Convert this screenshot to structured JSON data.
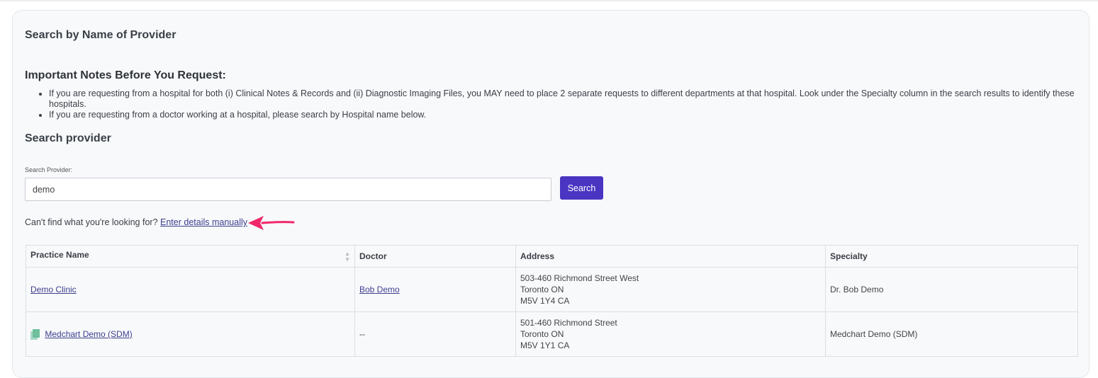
{
  "section_title": "Search by Name of Provider",
  "notes": {
    "title": "Important Notes Before You Request:",
    "items": [
      "If you are requesting from a hospital for both (i) Clinical Notes & Records and (ii) Diagnostic Imaging Files, you MAY need to place 2 separate requests to different departments at that hospital. Look under the Specialty column in the search results to identify these hospitals.",
      "If you are requesting from a doctor working at a hospital, please search by Hospital name below."
    ]
  },
  "search": {
    "title": "Search provider",
    "label": "Search Provider:",
    "value": "demo",
    "button_label": "Search"
  },
  "manual": {
    "prompt": "Can't find what you're looking for?",
    "link_label": "Enter details manually"
  },
  "table": {
    "headers": [
      "Practice Name",
      "Doctor",
      "Address",
      "Specialty"
    ],
    "rows": [
      {
        "practice": "Demo Clinic",
        "doctor": "Bob Demo",
        "address": [
          "503-460 Richmond Street West",
          "Toronto ON",
          "M5V 1Y4 CA"
        ],
        "specialty": "Dr. Bob Demo"
      },
      {
        "practice": "Medchart Demo (SDM)",
        "doctor": "--",
        "address": [
          "501-460 Richmond Street",
          "Toronto ON",
          "M5V 1Y1 CA"
        ],
        "specialty": "Medchart Demo (SDM)"
      }
    ]
  },
  "colors": {
    "accent": "#4a35c2",
    "link": "#3e3f8e",
    "annotation_arrow": "#f0286a",
    "card_bg": "#f8f9fb"
  },
  "icons": {
    "sort": "sort-icon",
    "sdm": "document-icon",
    "annotation": "arrow-left-icon"
  }
}
